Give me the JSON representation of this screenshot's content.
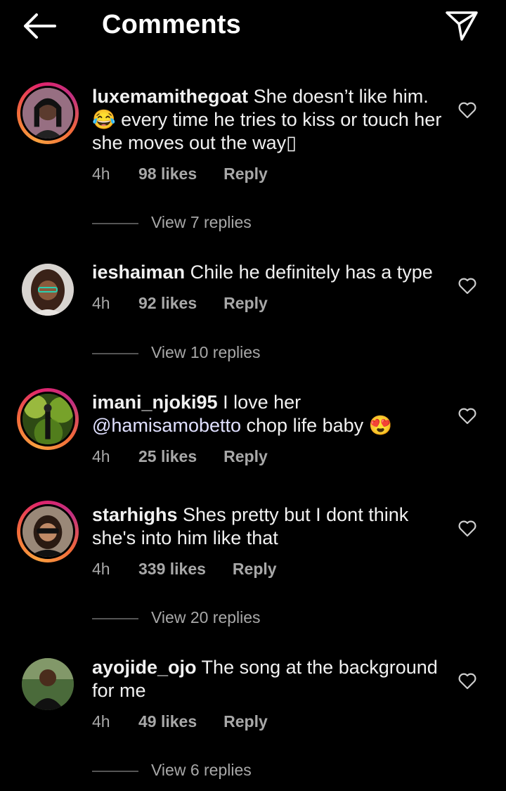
{
  "header": {
    "title": "Comments",
    "back_icon": "arrow-left-icon",
    "share_icon": "paper-plane-icon"
  },
  "comments": [
    {
      "username": "luxemamithegoat",
      "text_1": " She doesn’t like him.",
      "emoji": "😂",
      "text_2": " every time he tries to kiss or touch her she moves out the way▯",
      "time": "4h",
      "likes": "98 likes",
      "reply": "Reply",
      "view_replies": "View 7 replies"
    },
    {
      "username": "ieshaiman",
      "text_1": " Chile he definitely has a type",
      "time": "4h",
      "likes": "92 likes",
      "reply": "Reply",
      "view_replies": "View 10 replies"
    },
    {
      "username": "imani_njoki95",
      "text_1": " I love her ",
      "mention": "@hamisamobetto",
      "text_2": " chop life baby ",
      "emoji": "😍",
      "time": "4h",
      "likes": "25 likes",
      "reply": "Reply"
    },
    {
      "username": "starhighs",
      "text_1": " Shes pretty but I dont think she's into him like that",
      "time": "4h",
      "likes": "339 likes",
      "reply": "Reply",
      "view_replies": "View 20 replies"
    },
    {
      "username": "ayojide_ojo",
      "text_1": " The song at the background for me",
      "time": "4h",
      "likes": "49 likes",
      "reply": "Reply",
      "view_replies": "View 6 replies"
    }
  ]
}
